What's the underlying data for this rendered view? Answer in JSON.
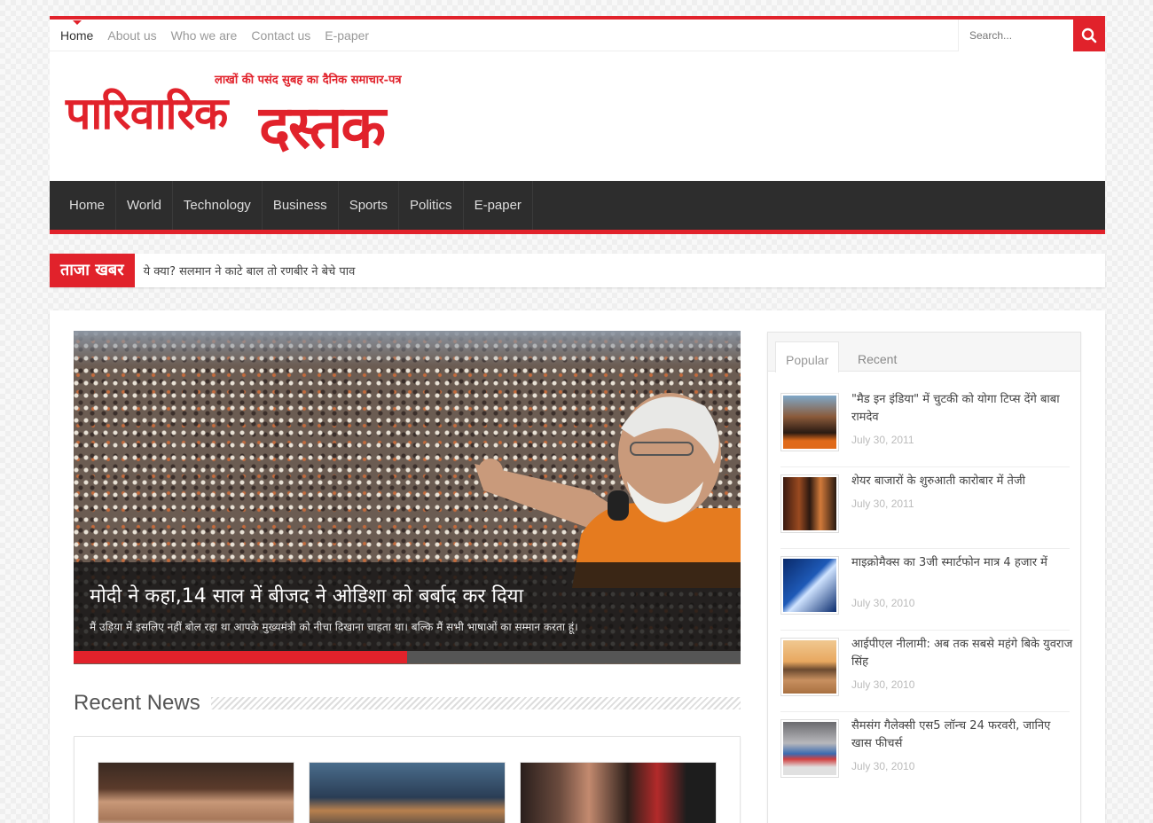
{
  "top_nav": {
    "items": [
      "Home",
      "About us",
      "Who we are",
      "Contact us",
      "E-paper"
    ],
    "active": "Home"
  },
  "search": {
    "placeholder": "Search..."
  },
  "logo": {
    "tagline": "लाखों की पसंद सुबह का दैनिक समाचार-पत्र",
    "part1": "पारिवारिक",
    "part2": "दस्तक"
  },
  "main_nav": [
    "Home",
    "World",
    "Technology",
    "Business",
    "Sports",
    "Politics",
    "E-paper"
  ],
  "breaking": {
    "label": "ताजा खबर",
    "text": "ये क्या? सलमान ने काटे बाल तो रणबीर ने बेचे पाव"
  },
  "slider": {
    "title": "मोदी ने कहा,14 साल में बीजद ने ओडिशा को बर्बाद कर दिया",
    "excerpt": "मैं उड़िया में इसलिए नहीं बोल रहा था आपके मुख्यमंत्री को नीचा दिखाना चाहता था। बल्कि मैं सभी भाषाओं का सम्मान करता हूं।",
    "progress_fraction": 0.5
  },
  "recent_news": {
    "heading": "Recent News"
  },
  "sidebar": {
    "tabs": [
      "Popular",
      "Recent"
    ],
    "items": [
      {
        "title": "\"मैड इन इंडिया\" में चुटकी को योगा टिप्स देंगे बाबा रामदेव",
        "date": "July 30, 2011"
      },
      {
        "title": "शेयर बाजारों के शुरुआती कारोबार में तेजी",
        "date": "July 30, 2011"
      },
      {
        "title": "माइक्रोमैक्स का 3जी स्मार्टफोन मात्र 4 हजार में",
        "date": "July 30, 2010"
      },
      {
        "title": "आईपीएल नीलामी: अब तक सबसे महंगे बिके युवराज सिंह",
        "date": "July 30, 2010"
      },
      {
        "title": "सैमसंग गैलेक्सी एस5 लॉन्च 24 फरवरी, जानिए खास फीचर्स",
        "date": "July 30, 2010"
      }
    ]
  },
  "colors": {
    "accent": "#e1222b",
    "nav_bg": "#2d2d2d"
  }
}
